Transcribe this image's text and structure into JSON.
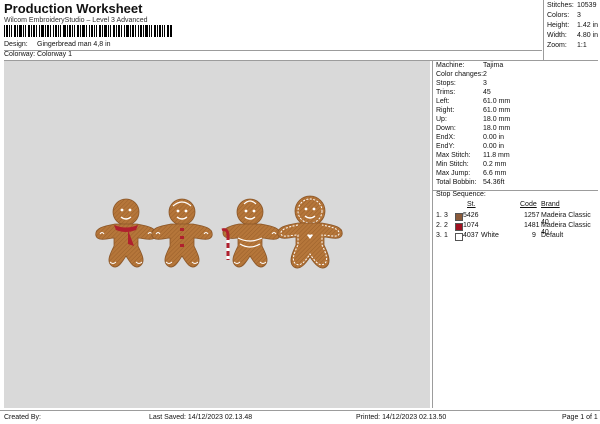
{
  "header": {
    "title": "Production Worksheet",
    "subtitle": "Wilcom EmbroideryStudio – Level 3 Advanced",
    "design_label": "Design:",
    "design_value": "Gingerbread man 4,8 in",
    "colorway_label": "Colorway:",
    "colorway_value": "Colorway 1"
  },
  "stats": [
    {
      "label": "Stitches:",
      "value": "10539"
    },
    {
      "label": "Colors:",
      "value": "3"
    },
    {
      "label": "Height:",
      "value": "1.42 in"
    },
    {
      "label": "Width:",
      "value": "4.80 in"
    },
    {
      "label": "Zoom:",
      "value": "1:1"
    }
  ],
  "machine_info": [
    {
      "label": "Machine:",
      "value": "Tajima"
    },
    {
      "label": "Color changes:",
      "value": "2"
    },
    {
      "label": "Stops:",
      "value": "3"
    },
    {
      "label": "Trims:",
      "value": "45"
    },
    {
      "label": "Left:",
      "value": "61.0 mm"
    },
    {
      "label": "Right:",
      "value": "61.0 mm"
    },
    {
      "label": "Up:",
      "value": "18.0 mm"
    },
    {
      "label": "Down:",
      "value": "18.0 mm"
    },
    {
      "label": "EndX:",
      "value": "0.00 in"
    },
    {
      "label": "EndY:",
      "value": "0.00 in"
    },
    {
      "label": "Max Stitch:",
      "value": "11.8 mm"
    },
    {
      "label": "Min Stitch:",
      "value": "0.2 mm"
    },
    {
      "label": "Max Jump:",
      "value": "6.6 mm"
    },
    {
      "label": "Total Bobbin:",
      "value": "54.36ft"
    }
  ],
  "stop_sequence": {
    "title": "Stop Sequence:",
    "headers": {
      "st": "St.",
      "code": "Code",
      "brand": "Brand"
    },
    "rows": [
      {
        "num": "1.",
        "stop": "3",
        "color": "#8a5a3a",
        "st": "5426",
        "stitches": "1257",
        "code": "Madeira Classic 40",
        "brand": ""
      },
      {
        "num": "2.",
        "stop": "2",
        "color": "#a01020",
        "st": "1074",
        "stitches": "1481",
        "code": "Madeira Classic 40",
        "brand": ""
      },
      {
        "num": "3.",
        "stop": "1",
        "color": "#ffffff",
        "st": "4037",
        "name": "White",
        "stitches": "9",
        "code": "Default",
        "brand": ""
      }
    ]
  },
  "footer": {
    "created_by": "Created By:",
    "last_saved": "Last Saved: 14/12/2023 02.13.48",
    "printed": "Printed: 14/12/2023 02.13.50",
    "page": "Page 1 of 1"
  },
  "colors": {
    "canvas_bg": "#d9d9d9",
    "gingerbread": "#b87a3e",
    "icing": "#ffffff",
    "scarf": "#b0202e"
  }
}
